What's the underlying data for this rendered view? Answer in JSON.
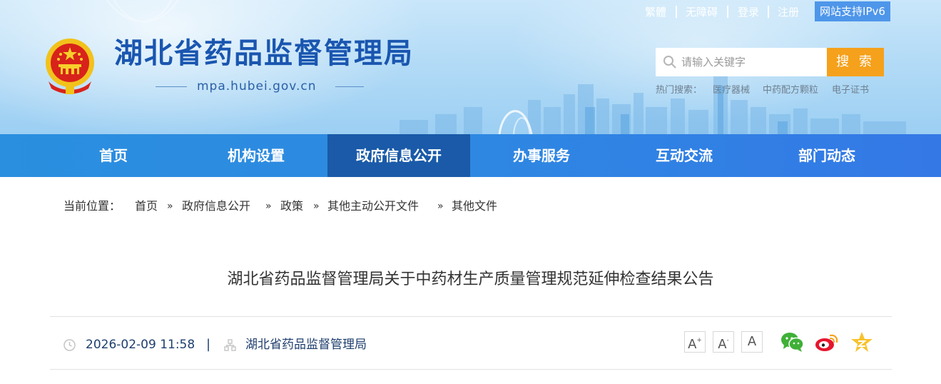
{
  "header": {
    "site_title": "湖北省药品监督管理局",
    "domain": "mpa.hubei.gov.cn",
    "top_links": [
      "繁體",
      "无障碍",
      "登录",
      "注册"
    ],
    "ipv6_badge": "网站支持IPv6",
    "search": {
      "placeholder": "请输入关键字",
      "button": "搜 索"
    },
    "hot_search": {
      "label": "热门搜索：",
      "items": [
        "医疗器械",
        "中药配方颗粒",
        "电子证书"
      ]
    }
  },
  "nav": {
    "items": [
      "首页",
      "机构设置",
      "政府信息公开",
      "办事服务",
      "互动交流",
      "部门动态"
    ],
    "active": "政府信息公开"
  },
  "breadcrumb": {
    "label": "当前位置：",
    "items": [
      "首页",
      "政府信息公开",
      "政策",
      "其他主动公开文件",
      "其他文件"
    ],
    "separator": "»"
  },
  "article": {
    "title": "湖北省药品监督管理局关于中药材生产质量管理规范延伸检查结果公告",
    "date": "2026-02-09 11:58",
    "meta_separator": "|",
    "source": "湖北省药品监督管理局",
    "font_size_buttons": [
      "A",
      "A",
      "A"
    ],
    "share_icons": [
      "wechat-icon",
      "weibo-icon",
      "qzone-icon"
    ]
  },
  "colors": {
    "nav_bg": "#2e88e2",
    "nav_active": "#1a5aa8",
    "title_blue": "#1a56b0",
    "search_button": "#f5a11c",
    "ipv6_badge": "#4e96ea"
  }
}
